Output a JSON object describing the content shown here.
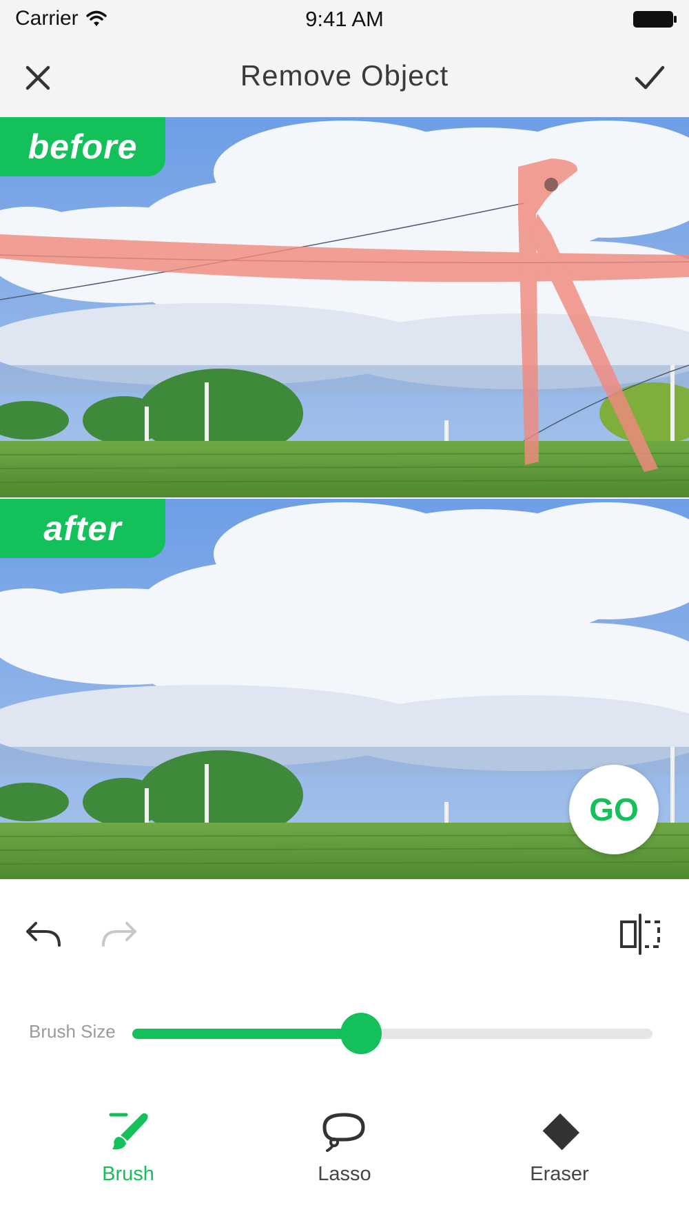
{
  "status_bar": {
    "carrier": "Carrier",
    "time": "9:41 AM",
    "icons": [
      "wifi-icon",
      "battery-icon"
    ]
  },
  "nav": {
    "title": "Remove Object",
    "left_icon": "close-icon",
    "right_icon": "checkmark-icon"
  },
  "preview": {
    "before_label": "before",
    "after_label": "after",
    "go_label": "GO"
  },
  "toolbar": {
    "icons": [
      "undo-icon",
      "redo-icon",
      "compare-icon"
    ],
    "redo_enabled": false
  },
  "brush_size": {
    "label": "Brush Size",
    "value_fraction": 0.44
  },
  "tabs": [
    {
      "label": "Brush",
      "icon": "brush-icon",
      "active": true
    },
    {
      "label": "Lasso",
      "icon": "lasso-icon",
      "active": false
    },
    {
      "label": "Eraser",
      "icon": "eraser-icon",
      "active": false
    }
  ],
  "colors": {
    "accent": "#13c05a",
    "mask": "#f08a7e",
    "sky": "#7aa8e8",
    "grass": "#5f9a3c",
    "inactive_icon": "#c8c8c8"
  }
}
